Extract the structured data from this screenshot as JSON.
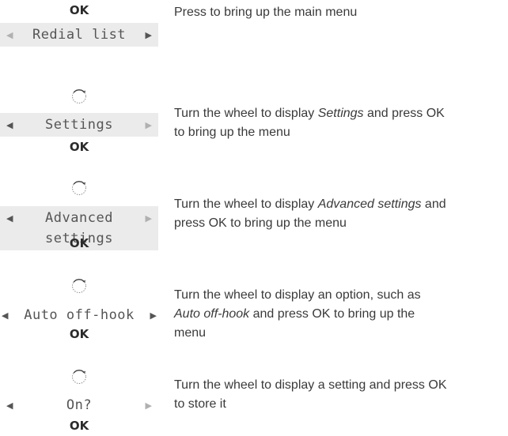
{
  "colors": {
    "text": "#3a3a3a",
    "display_bg": "#ebebeb",
    "arrow_active": "#555555",
    "arrow_inactive": "#b0b0b0"
  },
  "steps": [
    {
      "ok_top": "OK",
      "display": [
        "Redial list"
      ],
      "desc": [
        "Press to bring up the main menu"
      ]
    },
    {
      "wheel_icon": "rotate-wheel-icon",
      "display": [
        "Settings"
      ],
      "ok_bottom": "OK",
      "desc": {
        "a": "Turn the wheel to display ",
        "em": "Settings",
        "b": " and press OK",
        "line2": "to bring up the menu"
      }
    },
    {
      "wheel_icon": "rotate-wheel-icon",
      "display": [
        "Advanced",
        "settings"
      ],
      "ok_bottom": "OK",
      "desc": {
        "a": "Turn the wheel to display ",
        "em": "Advanced settings",
        "b": " and",
        "line2": "press OK to bring up the menu"
      }
    },
    {
      "wheel_icon": "rotate-wheel-icon",
      "display": [
        "Auto off-hook"
      ],
      "ok_bottom": "OK",
      "desc": {
        "line1": "Turn the wheel to display an option, such as",
        "em": "Auto off-hook",
        "b": " and press OK to bring up the",
        "line3": "menu"
      }
    },
    {
      "wheel_icon": "rotate-wheel-icon",
      "display": [
        "On?"
      ],
      "ok_bottom": "OK",
      "desc": {
        "line1": "Turn the wheel to display a setting and press OK",
        "line2": "to store it"
      }
    }
  ]
}
